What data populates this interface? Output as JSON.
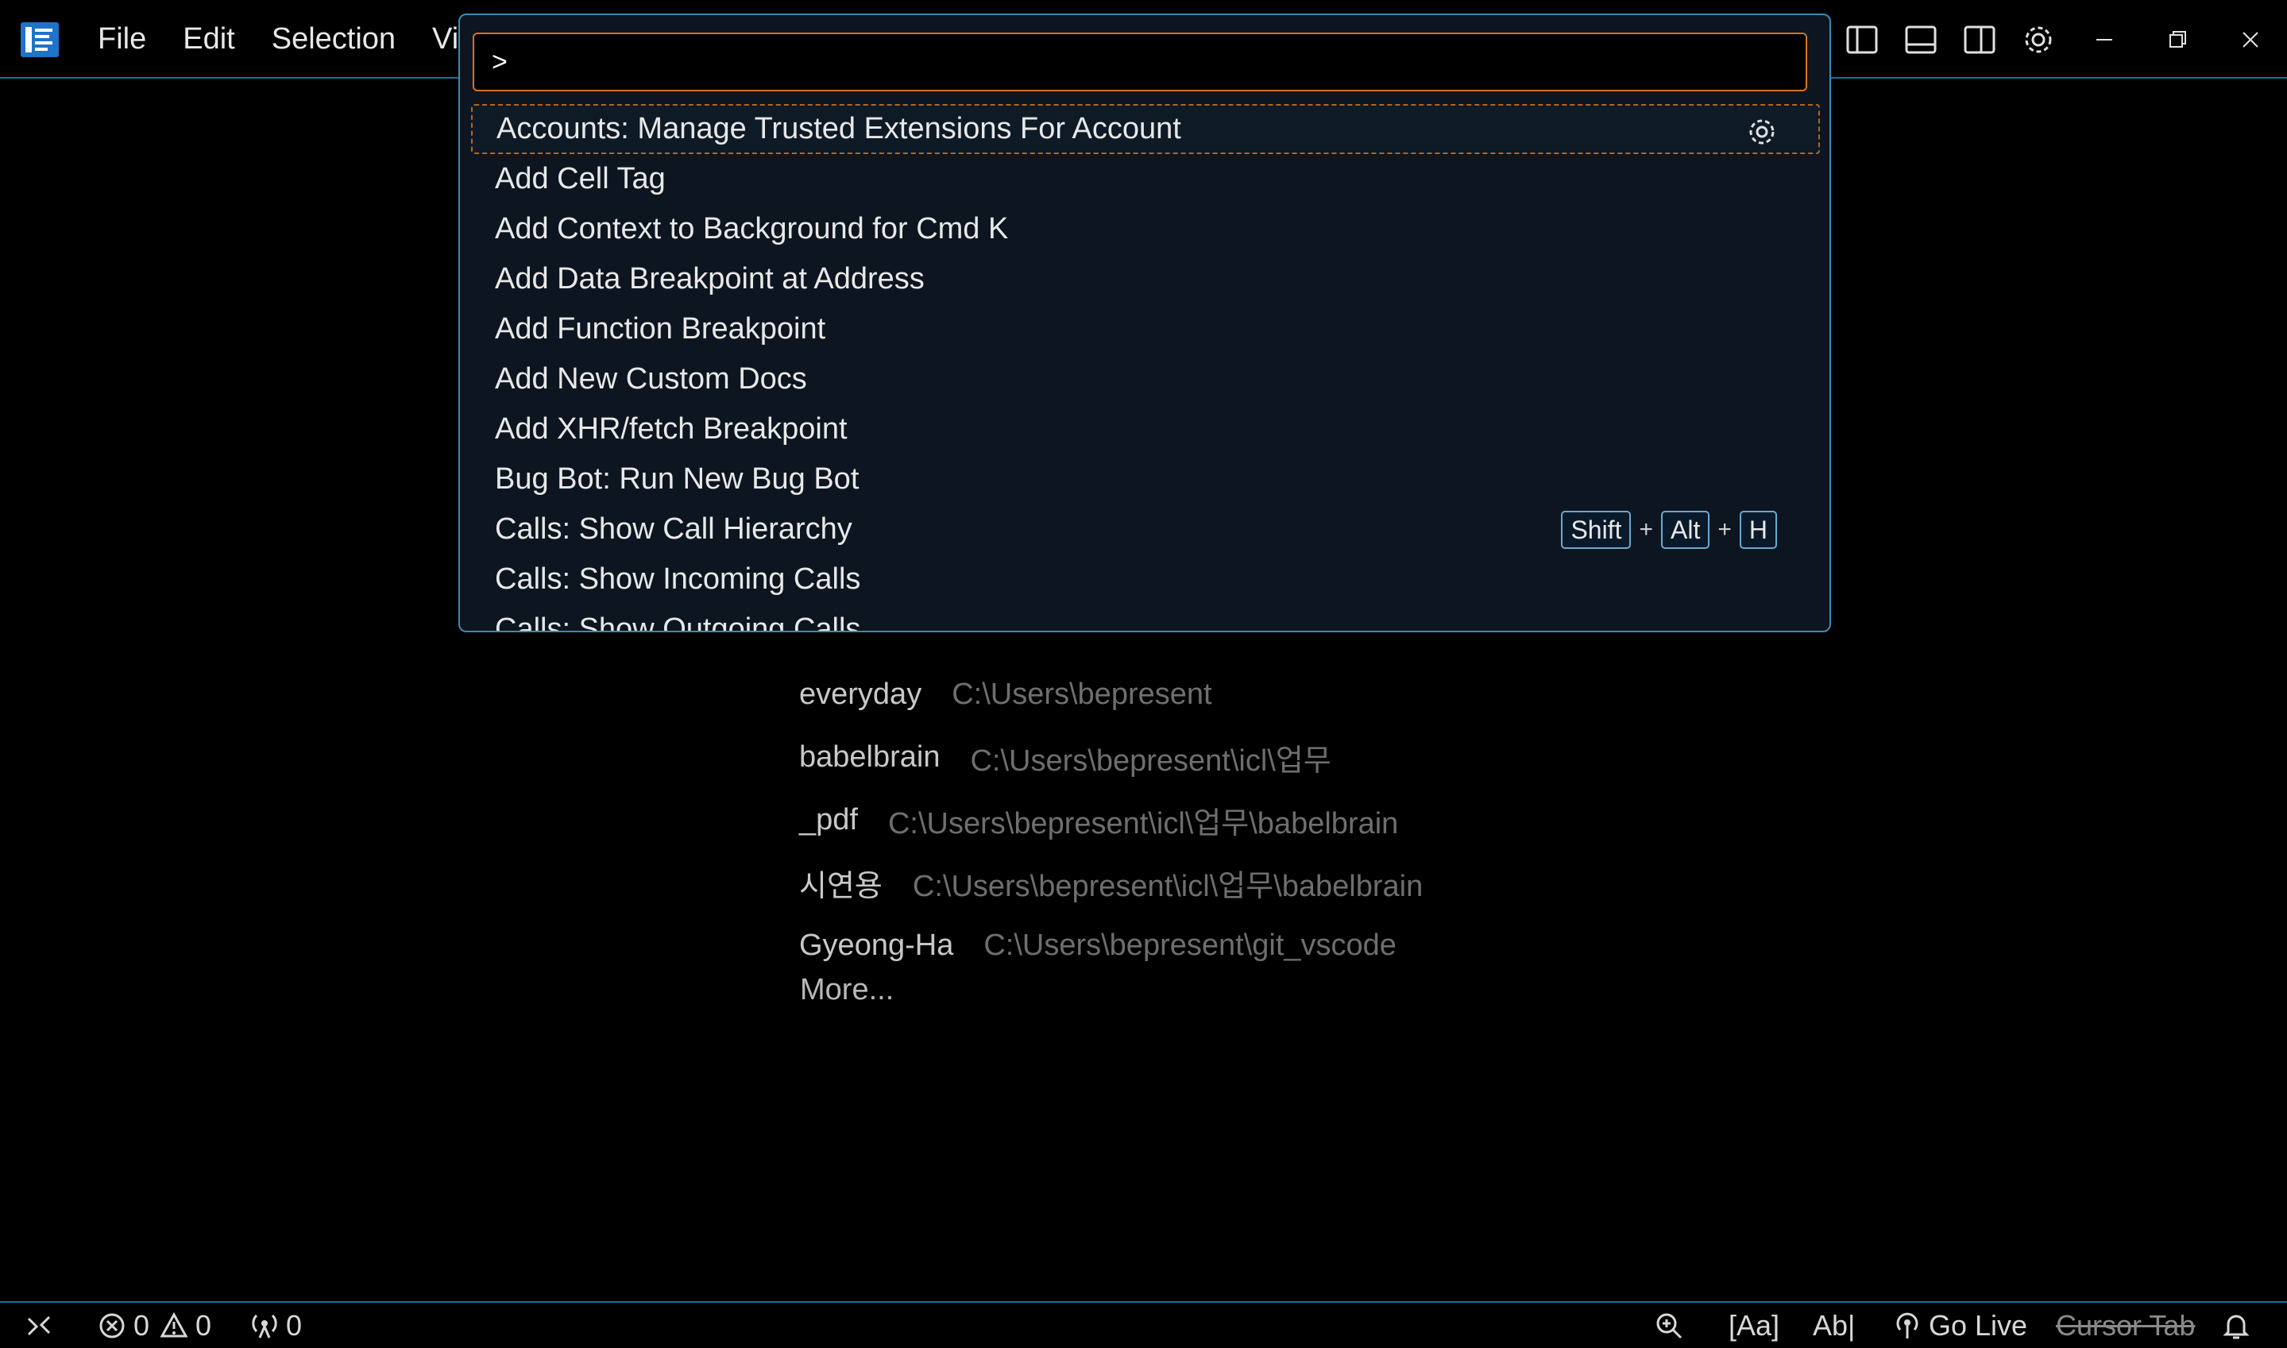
{
  "menu": {
    "file": "File",
    "edit": "Edit",
    "selection": "Selection",
    "view": "Vie"
  },
  "palette": {
    "input_value": ">",
    "commands": [
      {
        "label": "Accounts: Manage Trusted Extensions For Account"
      },
      {
        "label": "Add Cell Tag"
      },
      {
        "label": "Add Context to Background for Cmd K"
      },
      {
        "label": "Add Data Breakpoint at Address"
      },
      {
        "label": "Add Function Breakpoint"
      },
      {
        "label": "Add New Custom Docs"
      },
      {
        "label": "Add XHR/fetch Breakpoint"
      },
      {
        "label": "Bug Bot: Run New Bug Bot"
      },
      {
        "label": "Calls: Show Call Hierarchy"
      },
      {
        "label": "Calls: Show Incoming Calls"
      },
      {
        "label": "Calls: Show Outgoing Calls"
      }
    ],
    "keybinding": {
      "k1": "Shift",
      "plus": "+",
      "k2": "Alt",
      "k3": "H"
    }
  },
  "recent": [
    {
      "name": "everyday",
      "path": "C:\\Users\\bepresent"
    },
    {
      "name": "babelbrain",
      "path": "C:\\Users\\bepresent\\icl\\업무"
    },
    {
      "name": "_pdf",
      "path": "C:\\Users\\bepresent\\icl\\업무\\babelbrain"
    },
    {
      "name": "시연용",
      "path": "C:\\Users\\bepresent\\icl\\업무\\babelbrain"
    },
    {
      "name": "Gyeong-Ha",
      "path": "C:\\Users\\bepresent\\git_vscode"
    }
  ],
  "more_label": "More...",
  "status": {
    "errors": "0",
    "warnings": "0",
    "ports": "0",
    "case_label": "[Aa]",
    "word_label": "Ab|",
    "go_live": "Go Live",
    "cursor_tab": "Cursor Tab"
  },
  "colors": {
    "accent_border": "#3a8bb0",
    "focus_border": "#d9731c",
    "palette_bg": "#0d1520"
  }
}
